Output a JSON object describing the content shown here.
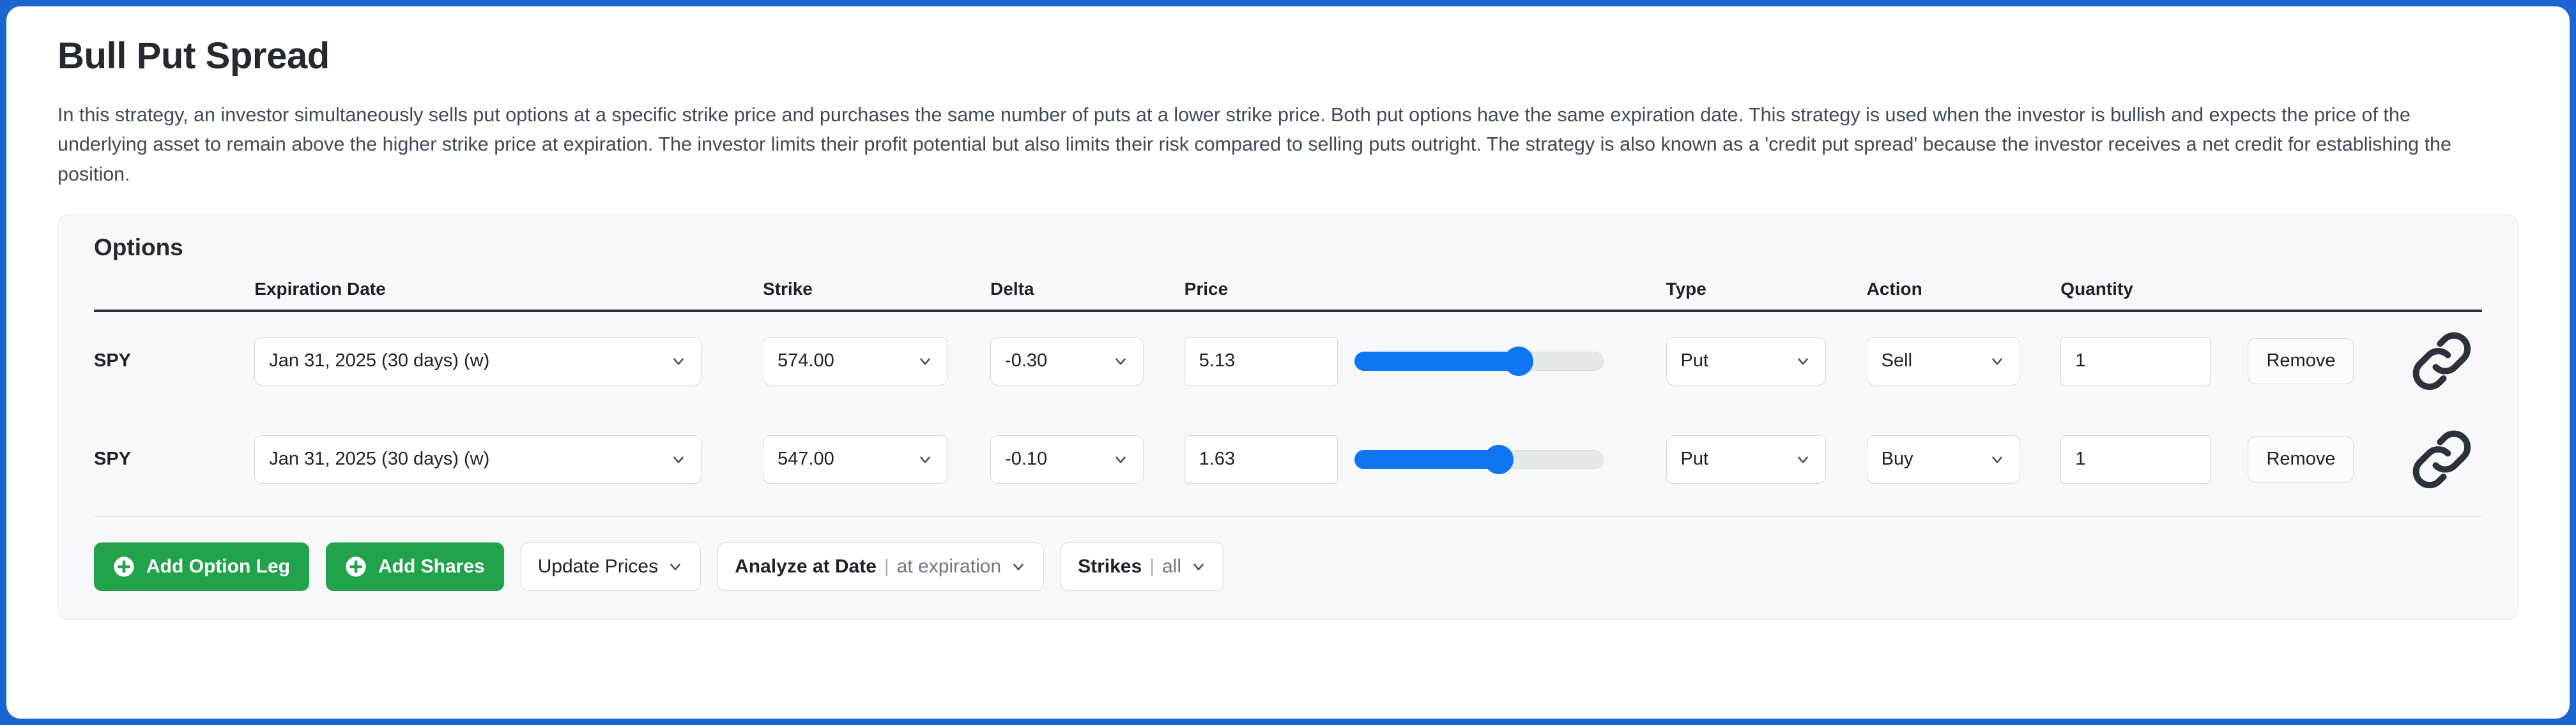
{
  "page": {
    "title": "Bull Put Spread",
    "description": "In this strategy, an investor simultaneously sells put options at a specific strike price and purchases the same number of puts at a lower strike price. Both put options have the same expiration date. This strategy is used when the investor is bullish and expects the price of the underlying asset to remain above the higher strike price at expiration. The investor limits their profit potential but also limits their risk compared to selling puts outright. The strategy is also known as a 'credit put spread' because the investor receives a net credit for establishing the position."
  },
  "options_panel": {
    "title": "Options",
    "columns": {
      "symbol": "",
      "expiration_date": "Expiration Date",
      "strike": "Strike",
      "delta": "Delta",
      "price": "Price",
      "type": "Type",
      "action": "Action",
      "quantity": "Quantity"
    },
    "rows": [
      {
        "symbol": "SPY",
        "expiration_date": "Jan 31, 2025 (30 days) (w)",
        "strike": "574.00",
        "delta": "-0.30",
        "price": "5.13",
        "slider_percent": 66,
        "type": "Put",
        "action": "Sell",
        "quantity": "1",
        "remove_label": "Remove",
        "link_icon": "chain-link-icon"
      },
      {
        "symbol": "SPY",
        "expiration_date": "Jan 31, 2025 (30 days) (w)",
        "strike": "547.00",
        "delta": "-0.10",
        "price": "1.63",
        "slider_percent": 58,
        "type": "Put",
        "action": "Buy",
        "quantity": "1",
        "remove_label": "Remove",
        "link_icon": "chain-link-icon"
      }
    ]
  },
  "footer": {
    "add_option_leg": "Add Option Leg",
    "add_shares": "Add Shares",
    "update_prices": "Update Prices",
    "analyze_at_date_label": "Analyze at Date",
    "analyze_at_date_value": "at expiration",
    "strikes_label": "Strikes",
    "strikes_value": "all",
    "separator": "|"
  },
  "colors": {
    "window_border": "#1A66D0",
    "panel_background": "#F7F8FA",
    "green_button": "#22A24B",
    "slider_blue": "#0D76F0",
    "text_primary": "#1C222B",
    "text_body": "#3E4A5B"
  }
}
